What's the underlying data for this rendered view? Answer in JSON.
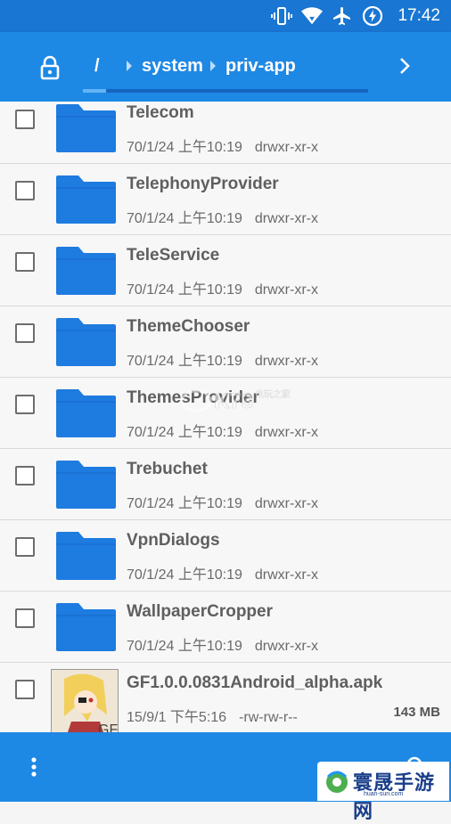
{
  "status": {
    "time": "17:42",
    "icons": [
      "vibrate-icon",
      "wifi-icon",
      "airplane-icon",
      "charging-icon"
    ]
  },
  "pathbar": {
    "root": "/",
    "crumbs": [
      "system",
      "priv-app"
    ],
    "progress": 0.08
  },
  "files": [
    {
      "name": "Telecom",
      "date": "70/1/24 上午10:19",
      "perm": "drwxr-xr-x",
      "type": "folder"
    },
    {
      "name": "TelephonyProvider",
      "date": "70/1/24 上午10:19",
      "perm": "drwxr-xr-x",
      "type": "folder"
    },
    {
      "name": "TeleService",
      "date": "70/1/24 上午10:19",
      "perm": "drwxr-xr-x",
      "type": "folder"
    },
    {
      "name": "ThemeChooser",
      "date": "70/1/24 上午10:19",
      "perm": "drwxr-xr-x",
      "type": "folder"
    },
    {
      "name": "ThemesProvider",
      "date": "70/1/24 上午10:19",
      "perm": "drwxr-xr-x",
      "type": "folder"
    },
    {
      "name": "Trebuchet",
      "date": "70/1/24 上午10:19",
      "perm": "drwxr-xr-x",
      "type": "folder"
    },
    {
      "name": "VpnDialogs",
      "date": "70/1/24 上午10:19",
      "perm": "drwxr-xr-x",
      "type": "folder"
    },
    {
      "name": "WallpaperCropper",
      "date": "70/1/24 上午10:19",
      "perm": "drwxr-xr-x",
      "type": "folder"
    },
    {
      "name": "GF1.0.0.0831Android_alpha.apk",
      "date": "15/9/1 下午5:16",
      "perm": "-rw-rw-r--",
      "size": "143 MB",
      "type": "apk"
    }
  ],
  "watermark": "K73 电玩之家",
  "brand": {
    "title": "寰晟手游网",
    "subtitle": "huan-sun.com"
  },
  "colors": {
    "primary": "#1e88e5",
    "status_bar": "#1976d2",
    "folder": "#1e7be0"
  }
}
